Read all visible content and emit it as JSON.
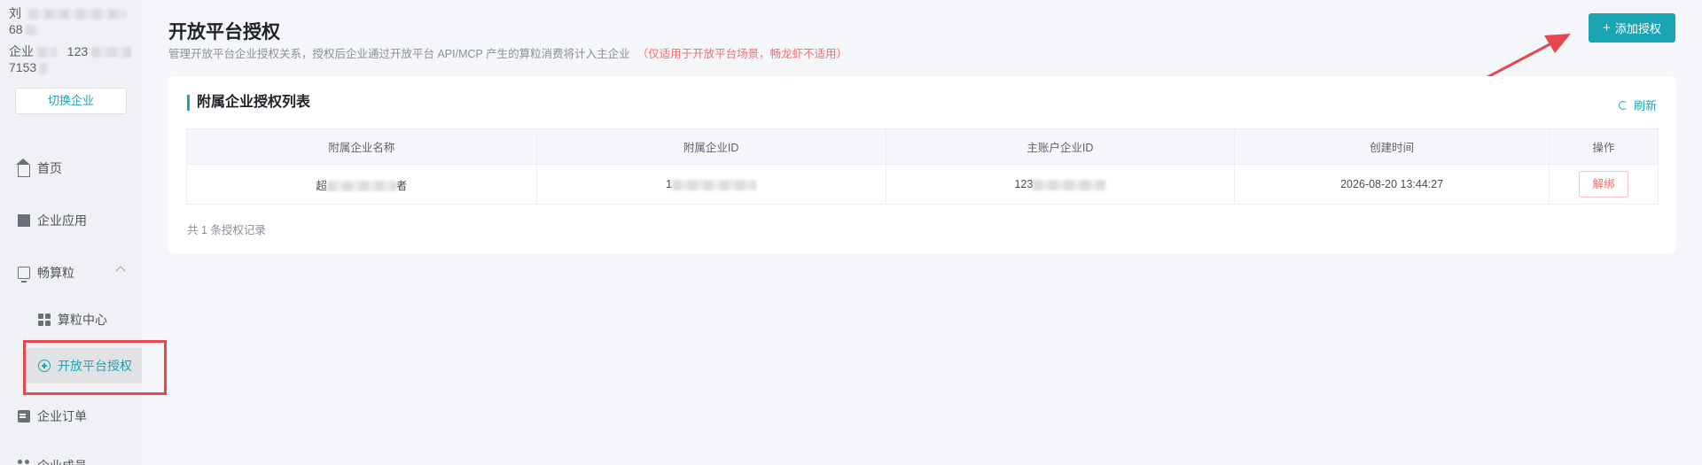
{
  "sidebar": {
    "user_line1": "刘",
    "user_line2": "68",
    "enterprise_line1_prefix": "企业",
    "enterprise_line1_value": "123",
    "enterprise_line2": "7153",
    "switch_label": "切换企业",
    "items": [
      {
        "label": "首页",
        "icon": "home-icon"
      },
      {
        "label": "企业应用",
        "icon": "building-icon"
      },
      {
        "label": "畅算粒",
        "icon": "monitor-icon",
        "expanded": true
      },
      {
        "label": "算粒中心",
        "icon": "grid-icon"
      },
      {
        "label": "开放平台授权",
        "icon": "plus-circle-icon",
        "active": true
      },
      {
        "label": "企业订单",
        "icon": "order-icon"
      },
      {
        "label": "企业成员",
        "icon": "members-icon"
      }
    ]
  },
  "header": {
    "title": "开放平台授权",
    "description": "管理开放平台企业授权关系，授权后企业通过开放平台 API/MCP 产生的算粒消费将计入主企业",
    "warning": "（仅适用于开放平台场景，畅龙虾不适用）",
    "add_button": "添加授权"
  },
  "card": {
    "title": "附属企业授权列表",
    "refresh_label": "刷新",
    "columns": [
      "附属企业名称",
      "附属企业ID",
      "主账户企业ID",
      "创建时间",
      "操作"
    ],
    "rows": [
      {
        "name_prefix": "超",
        "name_suffix": "者",
        "sub_id_prefix": "1",
        "main_id_prefix": "123",
        "created_at": "2026-08-20 13:44:27",
        "action": "解绑"
      }
    ],
    "total_text": "共 1 条授权记录"
  },
  "colors": {
    "accent": "#1aa5b5",
    "warning": "#f56c6c",
    "annotation": "#e5484d"
  }
}
